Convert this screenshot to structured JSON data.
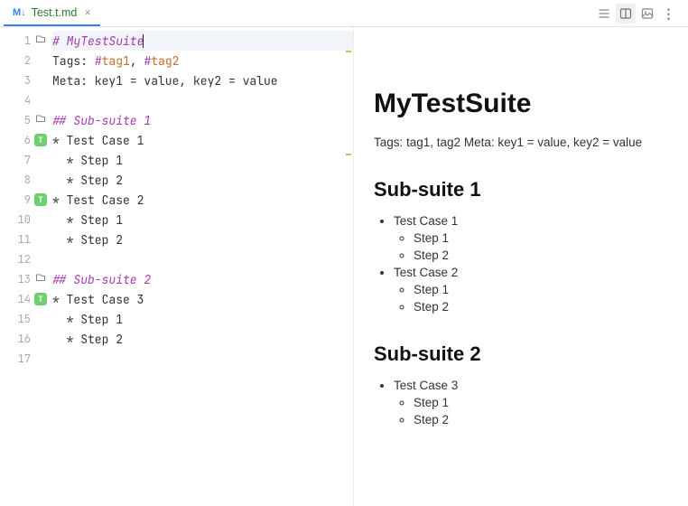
{
  "tab": {
    "icon": "M↓",
    "label": "Test.t.md"
  },
  "toolbar": {
    "warn_count": "1"
  },
  "editor": {
    "lines": [
      {
        "n": 1,
        "badge": "fold",
        "segs": [
          [
            "hd",
            "# MyTestSuite"
          ]
        ],
        "active": true
      },
      {
        "n": 2,
        "segs": [
          [
            "plain",
            "Tags: "
          ],
          [
            "kw",
            "#"
          ],
          [
            "tag",
            "tag1"
          ],
          [
            "plain",
            ", "
          ],
          [
            "kw",
            "#"
          ],
          [
            "tag",
            "tag2"
          ]
        ]
      },
      {
        "n": 3,
        "segs": [
          [
            "plain",
            "Meta: key1 = value, key2 = value"
          ]
        ]
      },
      {
        "n": 4,
        "segs": []
      },
      {
        "n": 5,
        "badge": "fold",
        "segs": [
          [
            "hd",
            "## Sub-suite 1"
          ]
        ]
      },
      {
        "n": 6,
        "badge": "T",
        "segs": [
          [
            "plain",
            "* Test Case 1"
          ]
        ]
      },
      {
        "n": 7,
        "segs": [
          [
            "plain",
            "  * Step 1"
          ]
        ]
      },
      {
        "n": 8,
        "segs": [
          [
            "plain",
            "  * Step 2"
          ]
        ]
      },
      {
        "n": 9,
        "badge": "T",
        "segs": [
          [
            "plain",
            "* Test Case 2"
          ]
        ]
      },
      {
        "n": 10,
        "segs": [
          [
            "plain",
            "  * Step 1"
          ]
        ]
      },
      {
        "n": 11,
        "segs": [
          [
            "plain",
            "  * Step 2"
          ]
        ]
      },
      {
        "n": 12,
        "segs": []
      },
      {
        "n": 13,
        "badge": "fold",
        "segs": [
          [
            "hd",
            "## Sub-suite 2"
          ]
        ]
      },
      {
        "n": 14,
        "badge": "T",
        "segs": [
          [
            "plain",
            "* Test Case 3"
          ]
        ]
      },
      {
        "n": 15,
        "segs": [
          [
            "plain",
            "  * Step 1"
          ]
        ]
      },
      {
        "n": 16,
        "segs": [
          [
            "plain",
            "  * Step 2"
          ]
        ]
      },
      {
        "n": 17,
        "segs": []
      }
    ]
  },
  "preview": {
    "h1": "MyTestSuite",
    "meta": "Tags: tag1, tag2 Meta: key1 = value, key2 = value",
    "s1": {
      "h": "Sub-suite 1",
      "c1": "Test Case 1",
      "c2": "Test Case 2",
      "st1": "Step 1",
      "st2": "Step 2"
    },
    "s2": {
      "h": "Sub-suite 2",
      "c1": "Test Case 3",
      "st1": "Step 1",
      "st2": "Step 2"
    }
  }
}
